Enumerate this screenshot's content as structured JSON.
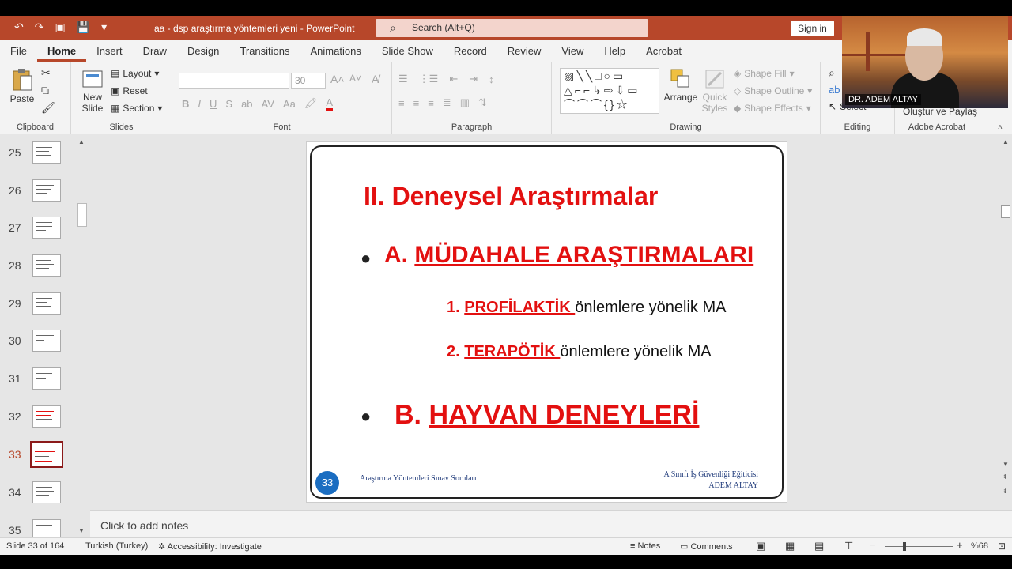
{
  "window": {
    "doc_title": "aa - dsp araştırma yöntemleri yeni  -  PowerPoint",
    "search_placeholder": "Search (Alt+Q)",
    "signin_label": "Sign in"
  },
  "menu_tabs": [
    "File",
    "Home",
    "Insert",
    "Draw",
    "Design",
    "Transitions",
    "Animations",
    "Slide Show",
    "Record",
    "Review",
    "View",
    "Help",
    "Acrobat"
  ],
  "ribbon": {
    "clipboard": {
      "paste": "Paste",
      "group": "Clipboard"
    },
    "slides": {
      "new_slide_1": "New",
      "new_slide_2": "Slide",
      "layout": "Layout",
      "reset": "Reset",
      "section": "Section",
      "group": "Slides"
    },
    "font": {
      "size": "30",
      "group": "Font"
    },
    "paragraph": {
      "group": "Paragraph"
    },
    "drawing": {
      "arrange": "Arrange",
      "quick_styles_1": "Quick",
      "quick_styles_2": "Styles",
      "shape_fill": "Shape Fill",
      "shape_outline": "Shape Outline",
      "shape_effects": "Shape Effects",
      "group": "Drawing"
    },
    "editing": {
      "select": "Select",
      "group": "Editing"
    },
    "acrobat": {
      "create_share": "Oluştur ve Paylaş",
      "group": "Adobe Acrobat"
    }
  },
  "webcam": {
    "name": "DR. ADEM ALTAY"
  },
  "thumbnails": [
    {
      "num": "25",
      "active": false
    },
    {
      "num": "26",
      "active": false
    },
    {
      "num": "27",
      "active": false
    },
    {
      "num": "28",
      "active": false
    },
    {
      "num": "29",
      "active": false
    },
    {
      "num": "30",
      "active": false
    },
    {
      "num": "31",
      "active": false
    },
    {
      "num": "32",
      "active": false
    },
    {
      "num": "33",
      "active": true
    },
    {
      "num": "34",
      "active": false
    },
    {
      "num": "35",
      "active": false
    }
  ],
  "slide": {
    "title": "II. Deneysel Araştırmalar",
    "bullet_a_prefix": "A. ",
    "bullet_a": "MÜDAHALE ARAŞTIRMALARI",
    "sub1_num": "1. ",
    "sub1_red": "PROFİLAKTİK ",
    "sub1_rest": "önlemlere yönelik MA",
    "sub2_num": "2. ",
    "sub2_red": " TERAPÖTİK ",
    "sub2_rest": "önlemlere yönelik MA",
    "bullet_b_prefix": "B. ",
    "bullet_b": "HAYVAN DENEYLERİ",
    "page_number": "33",
    "footer_left": "Araştırma Yöntemleri Sınav Soruları",
    "footer_right_1": "A Sınıfı İş Güvenliği Eğiticisi",
    "footer_right_2": "ADEM ALTAY"
  },
  "notes_placeholder": "Click to add notes",
  "status": {
    "slide_info": "Slide 33 of 164",
    "language": "Turkish (Turkey)",
    "accessibility": "Accessibility: Investigate",
    "notes": "Notes",
    "comments": "Comments",
    "zoom": "%68",
    "zoom_level_percent": 68
  },
  "colors": {
    "accent": "#b7472a",
    "slide_red": "#e31010",
    "badge_blue": "#1a6dc1"
  }
}
